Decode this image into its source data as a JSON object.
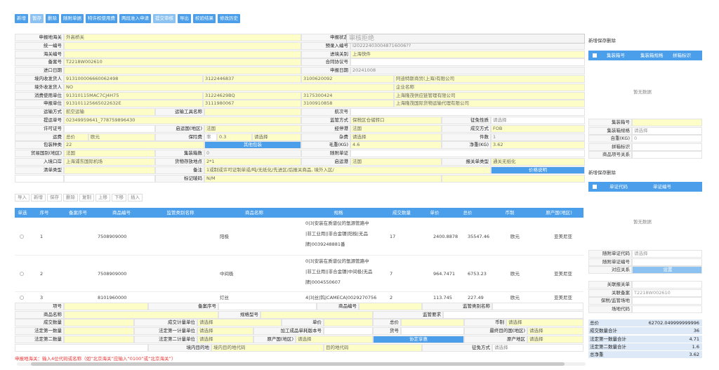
{
  "toolbar": [
    "新增",
    "暂存",
    "删除",
    "随附单据",
    "特许权使用费",
    "两段准入申请",
    "提交审核",
    "导出",
    "校验结果",
    "修改历史"
  ],
  "form": {
    "r1": [
      "申报地海关",
      "外高桥关",
      "申报状态",
      "审核拒绝"
    ],
    "r2": [
      "统一编号",
      "预录入编号",
      "I202224030048716006??"
    ],
    "r3": [
      "海关编号",
      "进境关别",
      "上海快件"
    ],
    "r4": [
      "备案号",
      "T2218W002610",
      "合同协议号"
    ],
    "r5": [
      "进口日期",
      "申报日期",
      "20241008"
    ],
    "r6": [
      "境内收发货人",
      "913100006660062498",
      "3122446837",
      "3100620092",
      "阿迪特斯商贸(上海)有限公司"
    ],
    "r7": [
      "境外收发货人",
      "NO",
      "企业名称"
    ],
    "r8": [
      "消费使用单位",
      "91310115MAC7CJ4H75",
      "31224629BQ",
      "3175300424",
      "上海隆茂供应链管理有限公司"
    ],
    "r9": [
      "申报单位",
      "913101125665022632E",
      "3111980067",
      "3100910858",
      "上海隆茂国际货物运输代理有限公司"
    ],
    "r10": [
      "运输方式",
      "航空运输",
      "运输工具名称",
      "航次号"
    ],
    "r11": [
      "提运单号",
      "02349959641_778759896430",
      "监管方式",
      "保税区仓储转口",
      "征免性质",
      "请选择"
    ],
    "r12": [
      "许可证号",
      "启运国(地区)",
      "法国",
      "经停港",
      "法国",
      "成交方式",
      "FOB"
    ],
    "r13": [
      "运费",
      "总价",
      "欧元",
      "保险费",
      "率",
      "0.3",
      "请选择",
      "杂费",
      "请选择",
      "件数",
      "1"
    ],
    "r14": [
      "包装种类",
      "22",
      "其他包装",
      "毛重(KG)",
      "4.6",
      "净重(KG)",
      "3.62"
    ],
    "r15": [
      "贸易国别(地区)",
      "法国",
      "集装箱数",
      "0",
      "随附单证"
    ],
    "r16": [
      "入境口岸",
      "上海浦东国际机场",
      "货物存放地点",
      "2*1",
      "启运港",
      "法国",
      "报关单类型",
      "通关无纸化"
    ],
    "r17": [
      "清单类型",
      "备注",
      "1或制或许可证制单或/吨/无纸化/先进区/后报关商品, 境外入区/",
      "价格说明"
    ],
    "r18": [
      "标记唛码",
      "N/M"
    ]
  },
  "grid_toolbar": [
    "导入",
    "新增",
    "保存",
    "删除",
    "复制",
    "上移",
    "下移",
    "插入"
  ],
  "grid": {
    "headers": [
      "单选",
      "序号",
      "备案序号",
      "商品编号",
      "监管类别名称",
      "商品名称",
      "规格",
      "成交数量",
      "单价",
      "总价",
      "币制",
      "原产国(地区)"
    ],
    "rows": [
      {
        "seq": "1",
        "code": "7508909000",
        "name": "阳极",
        "spec": [
          "0|3|安装在质谱仪的氩源管路中",
          "|非工业用||非合金镍|阳极|无品",
          "牌|0039248881番"
        ],
        "qty": "17",
        "price": "2400.8878",
        "total": "35547.46",
        "cur": "欧元",
        "origin": "亚美尼亚"
      },
      {
        "seq": "2",
        "code": "7508909000",
        "name": "中间极",
        "spec": [
          "0|3|安装在质谱仪的氩源管路中",
          "|非工业用||非合金镍|中间极|无品",
          "牌|0004550607"
        ],
        "qty": "7",
        "price": "964.7471",
        "total": "6753.23",
        "cur": "欧元",
        "origin": "亚美尼亚"
      },
      {
        "seq": "3",
        "code": "8101960000",
        "name": "灯丝",
        "spec": [
          "4|3|丝|钨|CAMECA|0029270756"
        ],
        "qty": "2",
        "price": "113.745",
        "total": "227.49",
        "cur": "欧元",
        "origin": "亚美尼亚"
      }
    ]
  },
  "detail": {
    "d1": [
      "项号",
      "备案序号",
      "商品编号",
      "监管类别名称"
    ],
    "d2": [
      "商品名称",
      "规格型号",
      "监管要求"
    ],
    "d3": [
      "成交数量",
      "成交计量单位",
      "请选择",
      "单价",
      "总价",
      "币制",
      "请选择"
    ],
    "d4": [
      "法定第一数量",
      "法定第一计量单位",
      "请选择",
      "加工成品单耗版本号",
      "货号",
      "最终目的国(地区)",
      "请选择"
    ],
    "d5": [
      "法定第二数量",
      "法定第二计量单位",
      "请选择",
      "原产国(地区)",
      "请选择",
      "协定享惠",
      "原产地区",
      "请选择"
    ],
    "d6": [
      "境内目的地",
      "境内目的地代码",
      "目的地代码",
      "征免方式",
      "请选择"
    ]
  },
  "error": "申报地海关：输入4位代码或名称（如“北京海关”应输入“0100”或“北京海关”）",
  "side": {
    "btns1": [
      "新增",
      "保存",
      "删除"
    ],
    "container_headers": [
      "集装箱号",
      "集装箱规格",
      "拼箱标识"
    ],
    "empty1": "暂无数据",
    "container_fields": [
      [
        "集装箱号",
        ""
      ],
      [
        "集装箱规格",
        "请选择"
      ],
      [
        "自重(KG)",
        "0"
      ],
      [
        "拼箱标识",
        ""
      ],
      [
        "商品项号关系",
        ""
      ]
    ],
    "btns2": [
      "新增",
      "保存",
      "删除"
    ],
    "doc_headers": [
      "单证代码",
      "单证编号"
    ],
    "empty2": "暂无数据",
    "doc_fields": [
      [
        "随附单证代码",
        "请选择"
      ],
      [
        "随附单证编号",
        ""
      ],
      [
        "对应关系",
        "设置"
      ]
    ],
    "rel_fields": [
      [
        "关联报关单",
        ""
      ],
      [
        "关联备案",
        "T2218W002610"
      ],
      [
        "保税/监管场地",
        ""
      ],
      [
        "场地代码",
        ""
      ]
    ],
    "totals": [
      [
        "总价",
        "62702.049999999996"
      ],
      [
        "成交数量合计",
        "36"
      ],
      [
        "法定第一数量合计",
        "4.71"
      ],
      [
        "法定第二数量合计",
        "1.6"
      ],
      [
        "总净重",
        "3.62"
      ]
    ]
  }
}
